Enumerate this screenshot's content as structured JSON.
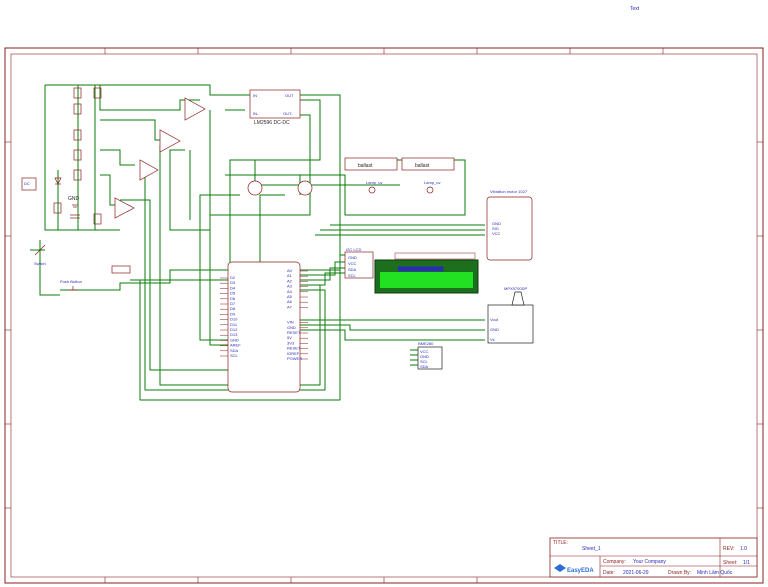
{
  "header": {
    "text_label": "Text"
  },
  "components": {
    "lm2596": "LM2596 DC-DC",
    "ballast_1": "ballast",
    "ballast_2": "ballast",
    "lamp_1": "Lamp_uv",
    "lamp_2": "Lamp_uv",
    "vibration": "Vibration motor 1027",
    "lcd": "I2C LCD",
    "lcd_screen_text": "████████████████",
    "sensor_top": "MPX5700DP",
    "sensor_small": "BME280",
    "switch": "Switch",
    "push_button": "Push Button",
    "gnd": "GND"
  },
  "mcu_pins": {
    "left": [
      "D2",
      "D3",
      "D4",
      "D5",
      "D6",
      "D7",
      "D8",
      "D9",
      "D10",
      "D11",
      "D12",
      "D13",
      "GND",
      "AREF",
      "SDA",
      "SCL"
    ],
    "right": [
      "A0",
      "A1",
      "A2",
      "A3",
      "A4",
      "A5",
      "A6",
      "A7",
      "VIN",
      "GND",
      "RESET",
      "5V",
      "3V3",
      "RESET",
      "IOREF",
      "POWER"
    ]
  },
  "title_block": {
    "title_label": "TITLE:",
    "title_value": "Sheet_1",
    "rev_label": "REV:",
    "rev_value": "1.0",
    "company_label": "Company:",
    "company_value": "Your Company",
    "sheet_label": "Sheet:",
    "sheet_value": "1/1",
    "date_label": "Date:",
    "date_value": "2021-06-29",
    "drawn_label": "Drawn By:",
    "drawn_value": "Minh Lâm Quốc",
    "logo": "EasyEDA"
  },
  "colors": {
    "frame": "#8a1f1f",
    "wire": "#0a7d0a",
    "text": "#2b2bb8",
    "lcd_screen": "#22e022"
  }
}
